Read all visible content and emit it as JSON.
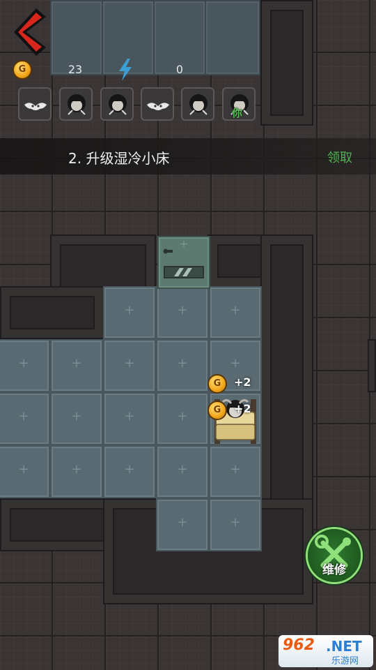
{
  "hud": {
    "gold": "23",
    "energy": "0",
    "gold_icon_letter": "G"
  },
  "inventory": {
    "slots": [
      {
        "icon": "ghost-bat-icon",
        "label": ""
      },
      {
        "icon": "girl-avatar-icon",
        "label": ""
      },
      {
        "icon": "girl-avatar-icon",
        "label": ""
      },
      {
        "icon": "ghost-bat-icon",
        "label": ""
      },
      {
        "icon": "girl-avatar-icon",
        "label": ""
      },
      {
        "icon": "girl-avatar-icon",
        "label": "你"
      }
    ]
  },
  "task": {
    "text": "2. 升级湿冷小床",
    "claim_label": "领取"
  },
  "bed": {
    "gain_1": "+2",
    "gain_2": "+2"
  },
  "repair": {
    "label": "维修",
    "icon": "wrench-screwdriver-icon"
  },
  "watermark": {
    "brand": "962",
    "suffix": ".NET",
    "subtitle": "乐游网"
  },
  "colors": {
    "accent_green": "#4fb24f",
    "back_arrow": "#d8261c",
    "floor_tile": "#5a6a72",
    "wall": "#3a3434"
  }
}
